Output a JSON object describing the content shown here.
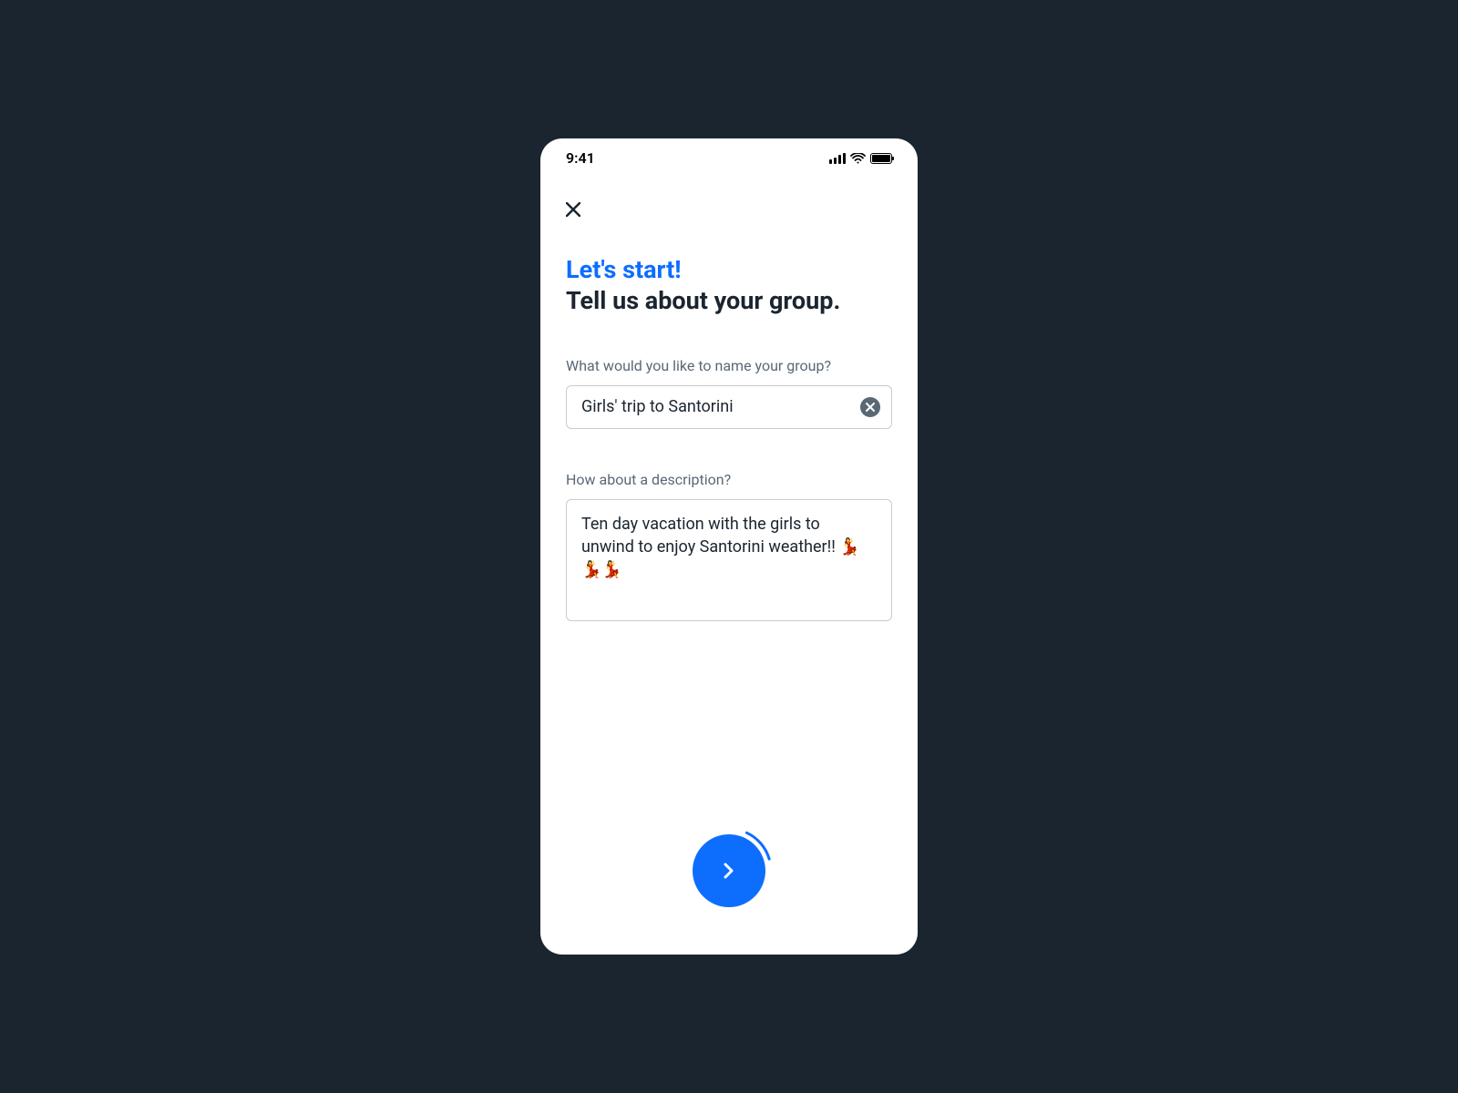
{
  "statusBar": {
    "time": "9:41"
  },
  "heading": {
    "accent": "Let's start!",
    "main": "Tell us about your group."
  },
  "fields": {
    "name": {
      "label": "What would you like to name your group?",
      "value": "Girls' trip to Santorini"
    },
    "description": {
      "label": "How about a description?",
      "value": "Ten day vacation with the girls to unwind to enjoy Santorini weather!! 💃💃💃"
    }
  }
}
